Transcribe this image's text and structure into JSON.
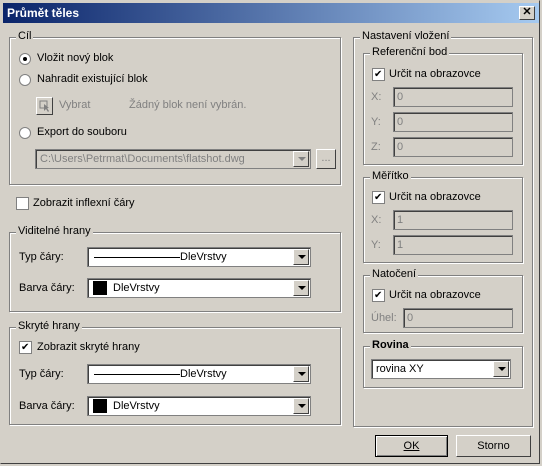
{
  "window": {
    "title": "Průmět těles",
    "close_glyph": "✕"
  },
  "cil": {
    "legend": "Cíl",
    "radio_new_block": "Vložit nový blok",
    "radio_replace": "Nahradit existující blok",
    "select_button": "Vybrat",
    "no_block_text": "Žádný blok není vybrán.",
    "radio_export": "Export do souboru",
    "file_path": "C:\\Users\\Petrmat\\Documents\\flatshot.dwg",
    "browse_label": "...",
    "selected_option": "Vložit nový blok"
  },
  "show_inflex": {
    "label": "Zobrazit inflexní čáry",
    "checked": false
  },
  "visible_edges": {
    "legend": "Viditelné hrany",
    "linetype_label": "Typ čáry:",
    "linetype_value": "DleVrstvy",
    "color_label": "Barva čáry:",
    "color_value": "DleVrstvy"
  },
  "hidden_edges": {
    "legend": "Skryté hrany",
    "show_label": "Zobrazit skryté hrany",
    "show_checked": true,
    "linetype_label": "Typ čáry:",
    "linetype_value": "DleVrstvy",
    "color_label": "Barva čáry:",
    "color_value": "DleVrstvy"
  },
  "insert_settings": {
    "legend": "Nastavení vložení",
    "ref_point": {
      "legend": "Referenční bod",
      "specify_label": "Určit na obrazovce",
      "checked": true,
      "x_label": "X:",
      "x_value": "0",
      "y_label": "Y:",
      "y_value": "0",
      "z_label": "Z:",
      "z_value": "0"
    },
    "scale": {
      "legend": "Měřítko",
      "specify_label": "Určit na obrazovce",
      "checked": true,
      "x_label": "X:",
      "x_value": "1",
      "y_label": "Y:",
      "y_value": "1"
    },
    "rotation": {
      "legend": "Natočení",
      "specify_label": "Určit na obrazovce",
      "checked": true,
      "angle_label": "Úhel:",
      "angle_value": "0"
    },
    "plane": {
      "legend": "Rovina",
      "value": "rovina XY"
    }
  },
  "buttons": {
    "ok": "OK",
    "cancel": "Storno"
  }
}
